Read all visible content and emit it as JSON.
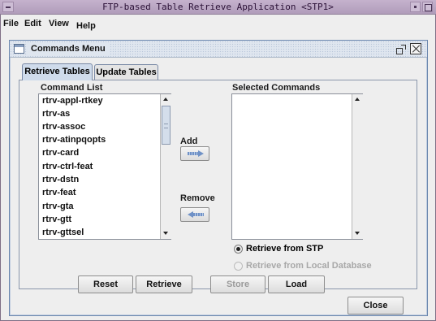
{
  "window": {
    "title": "FTP-based Table Retrieve Application <STP1>"
  },
  "menubar": {
    "items": [
      {
        "label": "File"
      },
      {
        "label": "Edit"
      },
      {
        "label": "View"
      },
      {
        "label": "Help"
      }
    ]
  },
  "commands_menu": {
    "title": "Commands Menu",
    "tabs": [
      {
        "label": "Retrieve Tables",
        "active": true
      },
      {
        "label": "Update Tables",
        "active": false
      }
    ],
    "command_list_label": "Command List",
    "command_list": [
      "rtrv-appl-rtkey",
      "rtrv-as",
      "rtrv-assoc",
      "rtrv-atinpqopts",
      "rtrv-card",
      "rtrv-ctrl-feat",
      "rtrv-dstn",
      "rtrv-feat",
      "rtrv-gta",
      "rtrv-gtt",
      "rtrv-gttsel"
    ],
    "selected_commands_label": "Selected Commands",
    "selected_commands": [],
    "add_label": "Add",
    "remove_label": "Remove",
    "radio_options": [
      {
        "label": "Retrieve from STP",
        "checked": true,
        "enabled": true
      },
      {
        "label": "Retrieve from Local Database",
        "checked": false,
        "enabled": false
      }
    ],
    "buttons": {
      "reset": "Reset",
      "retrieve": "Retrieve",
      "store": "Store",
      "load": "Load",
      "close": "Close"
    },
    "store_enabled": false
  },
  "colors": {
    "title_bar": "#b09cba",
    "frame_border": "#6b87ae",
    "active_tab": "#cfdbeb",
    "arrow_accent": "#6f91c6"
  }
}
